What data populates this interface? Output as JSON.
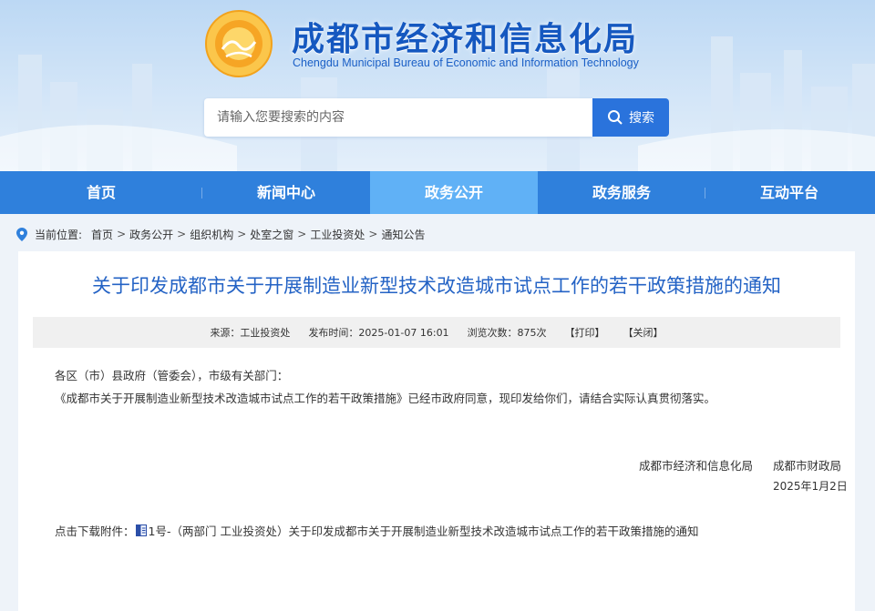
{
  "header": {
    "title": "成都市经济和信息化局",
    "subtitle": "Chengdu Municipal Bureau of Economic and Information Technology",
    "logo_icon": "sun-emblem-icon"
  },
  "search": {
    "placeholder": "请输入您要搜索的内容",
    "button_label": "搜索"
  },
  "nav": {
    "items": [
      {
        "label": "首页"
      },
      {
        "label": "新闻中心"
      },
      {
        "label": "政务公开",
        "active": true
      },
      {
        "label": "政务服务"
      },
      {
        "label": "互动平台"
      }
    ]
  },
  "breadcrumb": {
    "label": "当前位置:",
    "items": [
      "首页",
      "政务公开",
      "组织机构",
      "处室之窗",
      "工业投资处",
      "通知公告"
    ],
    "separator": ">"
  },
  "article": {
    "title": "关于印发成都市关于开展制造业新型技术改造城市试点工作的若干政策措施的通知",
    "meta": {
      "source": "来源：工业投资处",
      "published": "发布时间：2025-01-07 16:01",
      "views": "浏览次数：875次",
      "print": "【打印】",
      "close": "【关闭】"
    },
    "paragraphs": [
      "各区（市）县政府（管委会），市级有关部门：",
      "《成都市关于开展制造业新型技术改造城市试点工作的若干政策措施》已经市政府同意，现印发给你们，请结合实际认真贯彻落实。"
    ],
    "signature": {
      "org1": "成都市经济和信息化局",
      "org2": "成都市财政局",
      "date": "2025年1月2日"
    },
    "attachment": {
      "label": "点击下载附件：",
      "link_text": "1号-（两部门 工业投资处）关于印发成都市关于开展制造业新型技术改造城市试点工作的若干政策措施的通知"
    }
  },
  "colors": {
    "nav": "#2f80dc",
    "nav_active": "#60b1f6",
    "title_blue": "#2463c5",
    "search_button": "#2a73dc"
  }
}
